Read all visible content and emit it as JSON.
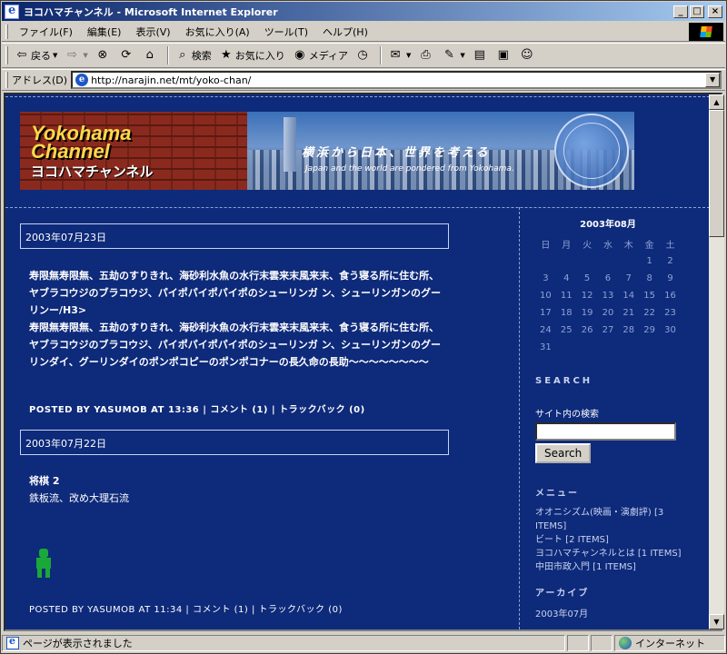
{
  "window": {
    "title": "ヨコハマチャンネル - Microsoft Internet Explorer",
    "minimize": "_",
    "maximize": "□",
    "close": "×"
  },
  "menubar": {
    "items": [
      "ファイル(F)",
      "編集(E)",
      "表示(V)",
      "お気に入り(A)",
      "ツール(T)",
      "ヘルプ(H)"
    ]
  },
  "toolbar": {
    "back": "戻る",
    "search": "検索",
    "favorites": "お気に入り",
    "media": "メディア"
  },
  "addressbar": {
    "label": "アドレス(D)",
    "url": "http://narajin.net/mt/yoko-chan/"
  },
  "banner": {
    "logo_en": "Yokohama Channel",
    "logo_jp": "ヨコハマチャンネル",
    "slogan_jp": "横浜から日本、世界を考える",
    "slogan_en": "Japan and the world are pondered from Yokohama."
  },
  "posts": [
    {
      "date": "2003年07月23日",
      "body": [
        "寿限無寿限無、五劫のすりきれ、海砂利水魚の水行末雲来末風来末、食う寝る所に住む所、ヤブラコウジのブラコウジ、パイポパイポパイポのシューリンガ ン、シューリンガンのグーリンー/H3>",
        "寿限無寿限無、五劫のすりきれ、海砂利水魚の水行末雲来末風来末、食う寝る所に住む所、ヤブラコウジのブラコウジ、パイポパイポパイポのシューリンガ ン、シューリンガンのグーリンダイ、グーリンダイのポンポコピーのポンポコナーの長久命の長助〜〜〜〜〜〜〜〜"
      ],
      "footer": {
        "prefix": "POSTED BY YASUMOB AT",
        "time": "13:36",
        "comments": "コメント (1)",
        "trackback": "トラックバック (0)"
      }
    },
    {
      "date": "2003年07月22日",
      "title": "将棋 2",
      "body": "鉄板流、改め大理石流",
      "footer": {
        "prefix": "POSTED BY YASUMOB AT",
        "time": "11:34",
        "comments": "コメント (1)",
        "trackback": "トラックバック (0)"
      }
    }
  ],
  "sidebar": {
    "calendar": {
      "title": "2003年08月",
      "weekdays": [
        "日",
        "月",
        "火",
        "水",
        "木",
        "金",
        "土"
      ],
      "weeks": [
        [
          "",
          "",
          "",
          "",
          "",
          "1",
          "2"
        ],
        [
          "3",
          "4",
          "5",
          "6",
          "7",
          "8",
          "9"
        ],
        [
          "10",
          "11",
          "12",
          "13",
          "14",
          "15",
          "16"
        ],
        [
          "17",
          "18",
          "19",
          "20",
          "21",
          "22",
          "23"
        ],
        [
          "24",
          "25",
          "26",
          "27",
          "28",
          "29",
          "30"
        ],
        [
          "31",
          "",
          "",
          "",
          "",
          "",
          ""
        ]
      ]
    },
    "search_heading": "SEARCH",
    "search_label": "サイト内の検索",
    "search_button": "Search",
    "menu_heading": "メニュー",
    "menu_items": [
      "オオニシズム(映画・演劇評) [3 ITEMS]",
      "ビート [2 ITEMS]",
      "ヨコハマチャンネルとは [1 ITEMS]",
      "中田市政入門 [1 ITEMS]"
    ],
    "archive_heading": "アーカイブ",
    "archive_items": [
      "2003年07月"
    ]
  },
  "statusbar": {
    "message": "ページが表示されました",
    "zone": "インターネット"
  }
}
